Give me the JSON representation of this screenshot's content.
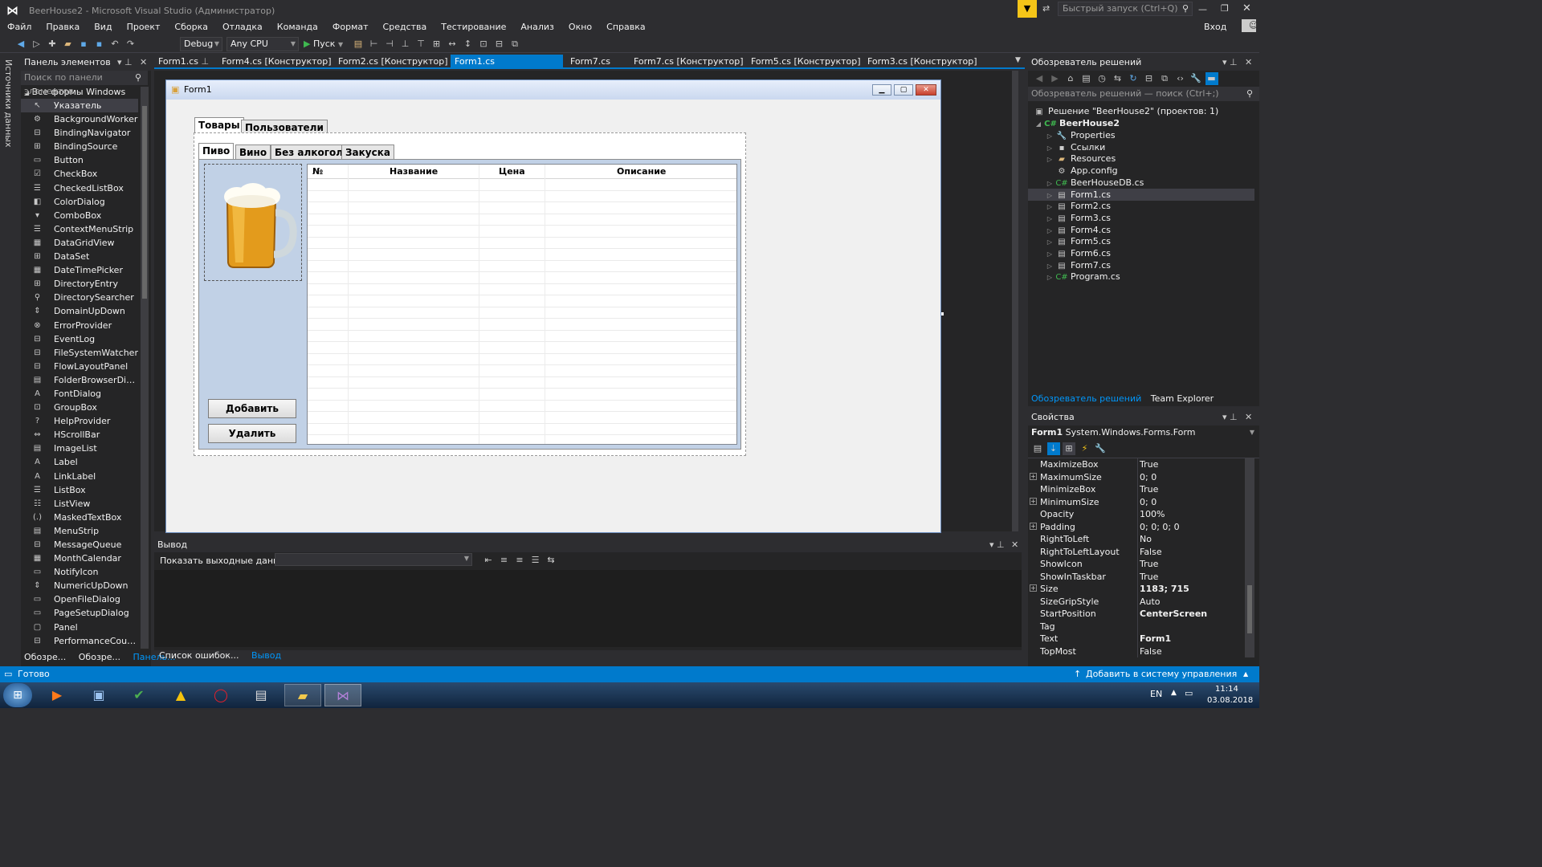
{
  "window": {
    "title": "BeerHouse2 - Microsoft Visual Studio (Администратор)",
    "quick_launch_placeholder": "Быстрый запуск (Ctrl+Q)",
    "signin": "Вход"
  },
  "menu": [
    "Файл",
    "Правка",
    "Вид",
    "Проект",
    "Сборка",
    "Отладка",
    "Команда",
    "Формат",
    "Средства",
    "Тестирование",
    "Анализ",
    "Окно",
    "Справка"
  ],
  "toolbar": {
    "config": "Debug",
    "platform": "Any CPU",
    "start": "Пуск"
  },
  "left_strip": "Источники данных",
  "toolbox": {
    "title": "Панель элементов",
    "search_placeholder": "Поиск по панели элементов",
    "group": "Все формы Windows Forms",
    "items": [
      "Указатель",
      "BackgroundWorker",
      "BindingNavigator",
      "BindingSource",
      "Button",
      "CheckBox",
      "CheckedListBox",
      "ColorDialog",
      "ComboBox",
      "ContextMenuStrip",
      "DataGridView",
      "DataSet",
      "DateTimePicker",
      "DirectoryEntry",
      "DirectorySearcher",
      "DomainUpDown",
      "ErrorProvider",
      "EventLog",
      "FileSystemWatcher",
      "FlowLayoutPanel",
      "FolderBrowserDialog",
      "FontDialog",
      "GroupBox",
      "HelpProvider",
      "HScrollBar",
      "ImageList",
      "Label",
      "LinkLabel",
      "ListBox",
      "ListView",
      "MaskedTextBox",
      "MenuStrip",
      "MessageQueue",
      "MonthCalendar",
      "NotifyIcon",
      "NumericUpDown",
      "OpenFileDialog",
      "PageSetupDialog",
      "Panel",
      "PerformanceCounter"
    ],
    "bottom_tabs": [
      "Обозре...",
      "Обозре...",
      "Панель..."
    ]
  },
  "doc_tabs": [
    "Form1.cs",
    "Form4.cs [Конструктор]",
    "Form2.cs [Конструктор]",
    "Form1.cs [Конструктор]",
    "Form7.cs",
    "Form7.cs [Конструктор]",
    "Form5.cs [Конструктор]",
    "Form3.cs [Конструктор]"
  ],
  "form": {
    "title": "Form1",
    "outer_tabs": [
      "Товары",
      "Пользователи"
    ],
    "inner_tabs": [
      "Пиво",
      "Вино",
      "Без алкогол.",
      "Закуска"
    ],
    "grid_columns": [
      "№",
      "Название",
      "Цена",
      "Описание"
    ],
    "add_button": "Добавить",
    "delete_button": "Удалить"
  },
  "output": {
    "title": "Вывод",
    "show_from_label": "Показать выходные данные из:",
    "bottom_tabs": [
      "Список ошибок...",
      "Вывод"
    ]
  },
  "solution_explorer": {
    "title": "Обозреватель решений",
    "search_placeholder": "Обозреватель решений — поиск (Ctrl+;)",
    "solution": "Решение \"BeerHouse2\" (проектов: 1)",
    "project": "BeerHouse2",
    "items": [
      "Properties",
      "Ссылки",
      "Resources",
      "App.config",
      "BeerHouseDB.cs",
      "Form1.cs",
      "Form2.cs",
      "Form3.cs",
      "Form4.cs",
      "Form5.cs",
      "Form6.cs",
      "Form7.cs",
      "Program.cs"
    ],
    "tabs": [
      "Обозреватель решений",
      "Team Explorer"
    ]
  },
  "properties": {
    "title": "Свойства",
    "object_name": "Form1",
    "object_type": "System.Windows.Forms.Form",
    "rows": [
      {
        "name": "MaximizeBox",
        "value": "True",
        "expand": false,
        "bold": false
      },
      {
        "name": "MaximumSize",
        "value": "0; 0",
        "expand": true,
        "bold": false
      },
      {
        "name": "MinimizeBox",
        "value": "True",
        "expand": false,
        "bold": false
      },
      {
        "name": "MinimumSize",
        "value": "0; 0",
        "expand": true,
        "bold": false
      },
      {
        "name": "Opacity",
        "value": "100%",
        "expand": false,
        "bold": false
      },
      {
        "name": "Padding",
        "value": "0; 0; 0; 0",
        "expand": true,
        "bold": false
      },
      {
        "name": "RightToLeft",
        "value": "No",
        "expand": false,
        "bold": false
      },
      {
        "name": "RightToLeftLayout",
        "value": "False",
        "expand": false,
        "bold": false
      },
      {
        "name": "ShowIcon",
        "value": "True",
        "expand": false,
        "bold": false
      },
      {
        "name": "ShowInTaskbar",
        "value": "True",
        "expand": false,
        "bold": false
      },
      {
        "name": "Size",
        "value": "1183; 715",
        "expand": true,
        "bold": true
      },
      {
        "name": "SizeGripStyle",
        "value": "Auto",
        "expand": false,
        "bold": false
      },
      {
        "name": "StartPosition",
        "value": "CenterScreen",
        "expand": false,
        "bold": true
      },
      {
        "name": "Tag",
        "value": "",
        "expand": false,
        "bold": false
      },
      {
        "name": "Text",
        "value": "Form1",
        "expand": false,
        "bold": true
      },
      {
        "name": "TopMost",
        "value": "False",
        "expand": false,
        "bold": false
      }
    ]
  },
  "status": {
    "ready": "Готово",
    "source_control": "Добавить в систему управления версиями"
  },
  "taskbar": {
    "lang": "EN",
    "time": "11:14",
    "date": "03.08.2018"
  }
}
